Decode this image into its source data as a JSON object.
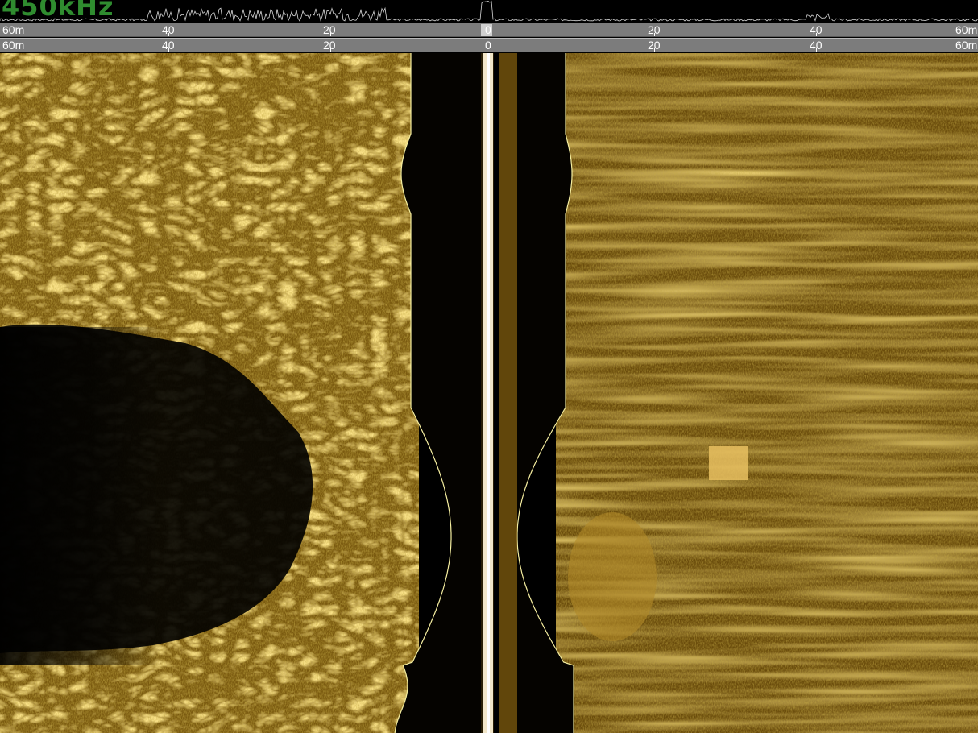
{
  "frequency_label": "450kHz",
  "range_scale": {
    "ticks_left": [
      "60m",
      "40",
      "20"
    ],
    "center": "0",
    "ticks_right": [
      "20",
      "40",
      "60m"
    ]
  },
  "colors": {
    "seabed_bright": "#f0c050",
    "seabed_mid": "#a07818",
    "seabed_dark": "#4a3608",
    "water_column": "#050300",
    "bottom_trace": "#f5eea0",
    "scale_bar": "#7c7c7c",
    "frequency_text": "#2f8c2f"
  }
}
